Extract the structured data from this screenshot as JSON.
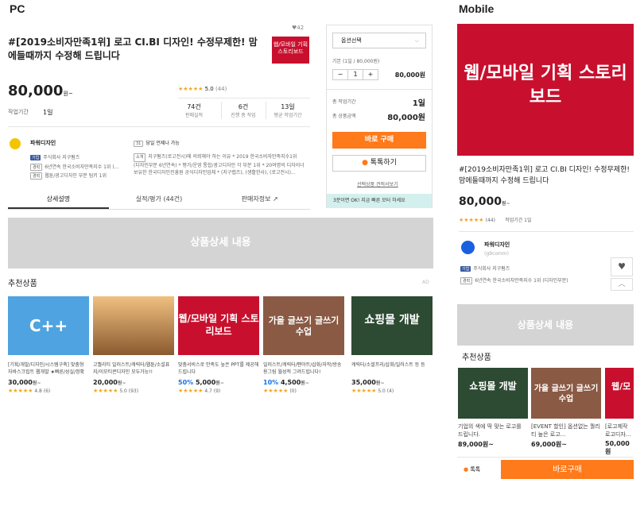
{
  "pc_label": "PC",
  "mobile_label": "Mobile",
  "product": {
    "title": "#[2019소비자만족1위] 로고 CI.BI 디자인! 수정무제한! 맘에들때까지 수정해 드립니다",
    "heart_count": "♥42",
    "thumb_text": "웹/모바일 기획 스토리보드",
    "price": "80,000",
    "price_suffix": "원~",
    "rating_stars": "★★★★★",
    "rating": "5.0",
    "rating_count": "(44)",
    "work_period_label": "작업기간",
    "work_period": "1일",
    "stats": [
      {
        "value": "74건",
        "label": "판매실적"
      },
      {
        "value": "6건",
        "label": "진행 중 작업"
      },
      {
        "value": "13일",
        "label": "평균 작업기간"
      }
    ]
  },
  "seller": {
    "name": "파워디자인",
    "badge1": "기업",
    "company": "주식회사 지구펌즈",
    "badge2": "경력",
    "career": "6년연속 한국소비자만족지수 1위 (...",
    "badge3": "경력",
    "career2": "웹툰/광고디자인 부문 팀키 1위",
    "oneday_label": "당일 언제나 가능",
    "intro_badge": "소개",
    "intro": "지구펌즈(로고전시)에 의뢰해야 하는 이유 * 2019 한국소비자만족지수1위 (디자인부문 6년연속) * 평가/운영 통합/광고디자인 각 부분 1위 * 20여명의 디자이너 보유한 한국디자인진흥원 공식디자인업체 * (지구랩즈), (생활한사), (로고전시)..."
  },
  "tabs": [
    "상세설명",
    "실적/평가 (44건)",
    "판매자정보 ↗"
  ],
  "side": {
    "select_placeholder": "옵션선택",
    "option_line": "기본 (1일 / 80,000원)",
    "qty_minus": "−",
    "qty": "1",
    "qty_plus": "+",
    "option_price": "80,000원",
    "total_period_label": "총 작업기간",
    "total_period": "1일",
    "total_price_label": "총 상품금액",
    "total_price": "80,000원",
    "buy_label": "바로 구매",
    "talk_label": "톡톡하기",
    "option_compare": "선택상품 견적서보기",
    "banner": "3분이면 OK! 지금 빠른 모터 하세요"
  },
  "detail_placeholder": "상품상세 내용",
  "recommend_title": "추천상품",
  "ad_label": "AD",
  "recommend": [
    {
      "img_text": "C++",
      "title": "[기획/개발/디자인/시스템구축] 맞춤형 자바스크립트 웹개발 ★빠른/성실/정확 [로고/카탈로그...",
      "discount": "",
      "price": "30,000",
      "unit": "원~",
      "stars": "★★★★★",
      "rating": "4.8 (6)",
      "color": "#4fa3e0"
    },
    {
      "img_text": "",
      "title": "고퀄리티 일러스트/캐릭터/웹툰/소설표지/이모티콘디자인 모두가능!!",
      "discount": "",
      "price": "20,000",
      "unit": "원~",
      "stars": "★★★★★",
      "rating": "5.0 (93)",
      "color": "#d9a066"
    },
    {
      "img_text": "웹/모바일 기획 스토리보드",
      "title": "맞춤서비스로 만족도 높은 PPT를 제공해 드립니다",
      "discount": "50%",
      "price": "5,000",
      "unit": "원~",
      "stars": "★★★★★",
      "rating": "4.7 (9)",
      "color": "#c8102e"
    },
    {
      "img_text": "가을 글쓰기 글쓰기 수업",
      "title": "일러스트/캐릭터/팬아트/삽화/자작/방송용그림 월성적 그려드립니다!",
      "discount": "10%",
      "price": "4,500",
      "unit": "원~",
      "stars": "★★★★★",
      "rating": "(0)",
      "color": "#8a5a44"
    },
    {
      "img_text": "쇼핑몰 개발",
      "title": "캐릭터/소셜프리/삽화/일러스트 등 등",
      "discount": "",
      "price": "35,000",
      "unit": "원~",
      "stars": "★★★★★",
      "rating": "5.0 (4)",
      "color": "#2d4a32"
    }
  ],
  "mobile": {
    "hero_text": "웹/모바일 기획 스토리보드",
    "title": "#[2019소비자만족1위] 로고 CI.BI 디자인! 수정무제한! 맘에들때까지 수정해 드립니다",
    "price": "80,000",
    "price_suffix": "원~",
    "stars": "★★★★★",
    "rating_count": "(44)",
    "work_period": "작업기간 1일",
    "seller_name": "파워디자인",
    "seller_handle": "(g9comm)",
    "badge1": "기업",
    "company": "주식회사 지구펌즈",
    "badge2": "경력",
    "career": "6년연속 한국소비자만족지수 1위 (디자인부문)",
    "detail_placeholder": "상품상세 내용",
    "recommend_title": "추천상품",
    "cards": [
      {
        "img_text": "쇼핑몰 개발",
        "title": "기업의 색에 딱 맞는 로고를 드립니다.",
        "price": "89,000원~",
        "color": "#2d4a32"
      },
      {
        "img_text": "가을 글쓰기 글쓰기 수업",
        "title": "[EVENT 할인] 옵션없는 퀄리티 높은 로고...",
        "price": "69,000원~",
        "color": "#8a5a44"
      },
      {
        "img_text": "웹/모 기획 스",
        "title": "[로고제작 로고디자...",
        "price": "50,000원",
        "color": "#c8102e"
      }
    ],
    "talk_label": "톡톡",
    "buy_label": "바로구매"
  }
}
